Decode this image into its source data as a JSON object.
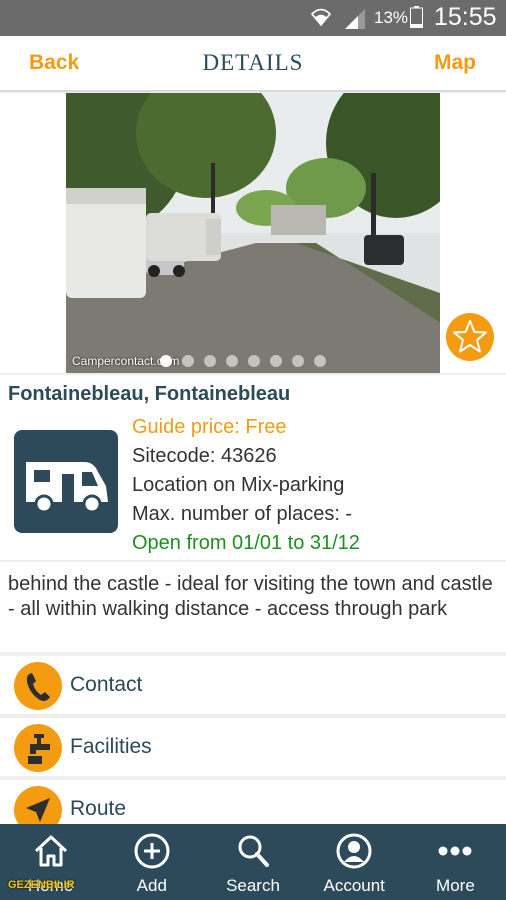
{
  "status": {
    "battery_pct": "13%",
    "time": "15:55"
  },
  "header": {
    "back": "Back",
    "title": "DETAILS",
    "map": "Map"
  },
  "photo": {
    "credit": "Campercontact.com",
    "dots_total": 9,
    "active_dot": 1
  },
  "place": {
    "name": "Fontainebleau, Fontainebleau",
    "price": "Guide price: Free",
    "sitecode": "Sitecode: 43626",
    "location": "Location on Mix-parking",
    "places": "Max. number of places: -",
    "open": "Open from 01/01 to 31/12"
  },
  "description": "behind the castle - ideal for visiting the town and castle - all within walking distance - access through park",
  "actions": [
    {
      "label": "Contact",
      "icon": "phone-icon"
    },
    {
      "label": "Facilities",
      "icon": "tap-icon"
    },
    {
      "label": "Route",
      "icon": "navigation-arrow-icon"
    }
  ],
  "tabs": [
    {
      "label": "Home",
      "icon": "home-icon"
    },
    {
      "label": "Add",
      "icon": "plus-circle-icon"
    },
    {
      "label": "Search",
      "icon": "search-icon"
    },
    {
      "label": "Account",
      "icon": "user-icon"
    },
    {
      "label": "More",
      "icon": "more-dots-icon"
    }
  ],
  "watermark": "GEZENBILIR",
  "colors": {
    "accent": "#f39c12",
    "primary": "#2d4a5a",
    "open": "#1f8f1f"
  }
}
